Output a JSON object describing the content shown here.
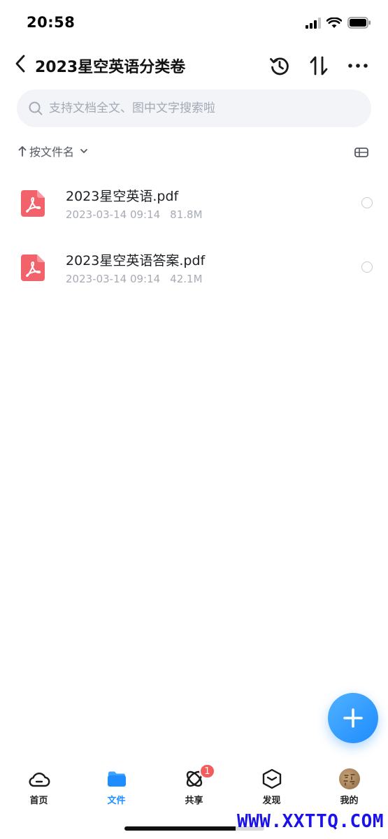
{
  "status_bar": {
    "time": "20:58"
  },
  "nav": {
    "title": "2023星空英语分类卷"
  },
  "search": {
    "placeholder": "支持文档全文、图中文字搜索啦"
  },
  "sort": {
    "label": "按文件名"
  },
  "files": [
    {
      "name": "2023星空英语.pdf",
      "date": "2023-03-14 09:14",
      "size": "81.8M"
    },
    {
      "name": "2023星空英语答案.pdf",
      "date": "2023-03-14 09:14",
      "size": "42.1M"
    }
  ],
  "tabs": [
    {
      "label": "首页"
    },
    {
      "label": "文件"
    },
    {
      "label": "共享",
      "badge": "1"
    },
    {
      "label": "发现"
    },
    {
      "label": "我的"
    }
  ],
  "watermark": "WWW.XXTTQ.COM",
  "colors": {
    "accent": "#1f8cff",
    "pdf": "#f2626a",
    "badge": "#f25c5c"
  }
}
